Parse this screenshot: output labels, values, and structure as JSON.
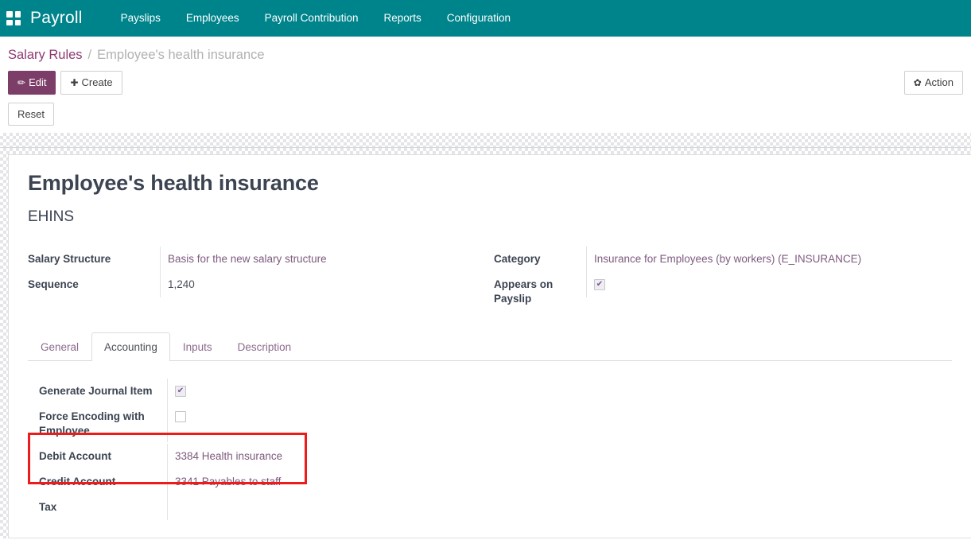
{
  "navbar": {
    "apps_icon": "apps-grid-icon",
    "brand": "Payroll",
    "links": [
      {
        "label": "Payslips"
      },
      {
        "label": "Employees"
      },
      {
        "label": "Payroll Contribution"
      },
      {
        "label": "Reports"
      },
      {
        "label": "Configuration"
      }
    ],
    "bg_color": "#00848b"
  },
  "breadcrumb": {
    "parent": "Salary Rules",
    "separator": "/",
    "current": "Employee's health insurance"
  },
  "control_panel": {
    "edit_label": "Edit",
    "edit_icon": "pencil-icon",
    "create_label": "Create",
    "create_icon": "plus-icon",
    "action_label": "Action",
    "action_icon": "gear-icon",
    "reset_label": "Reset",
    "primary_color": "#7c3e69"
  },
  "record": {
    "title": "Employee's health insurance",
    "code": "EHINS"
  },
  "fields": {
    "salary_structure": {
      "label": "Salary Structure",
      "value": "Basis for the new salary structure"
    },
    "sequence": {
      "label": "Sequence",
      "value": "1,240"
    },
    "category": {
      "label": "Category",
      "value": "Insurance for Employees (by workers) (E_INSURANCE)"
    },
    "appears_on_payslip": {
      "label": "Appears on Payslip",
      "checked": "✔"
    }
  },
  "notebook": {
    "tabs": [
      {
        "label": "General",
        "active": false
      },
      {
        "label": "Accounting",
        "active": true
      },
      {
        "label": "Inputs",
        "active": false
      },
      {
        "label": "Description",
        "active": false
      }
    ],
    "accounting": {
      "generate_journal_item": {
        "label": "Generate Journal Item",
        "checked": "✔"
      },
      "force_encoding": {
        "label": "Force Encoding with Employee",
        "checked": ""
      },
      "debit_account": {
        "label": "Debit Account",
        "value": "3384 Health insurance"
      },
      "credit_account": {
        "label": "Credit Account",
        "value": "3341 Payables to staff"
      },
      "tax": {
        "label": "Tax",
        "value": ""
      }
    }
  },
  "annotation": {
    "color": "#ee1b1b",
    "note": "highlight-debit-credit-accounts"
  }
}
